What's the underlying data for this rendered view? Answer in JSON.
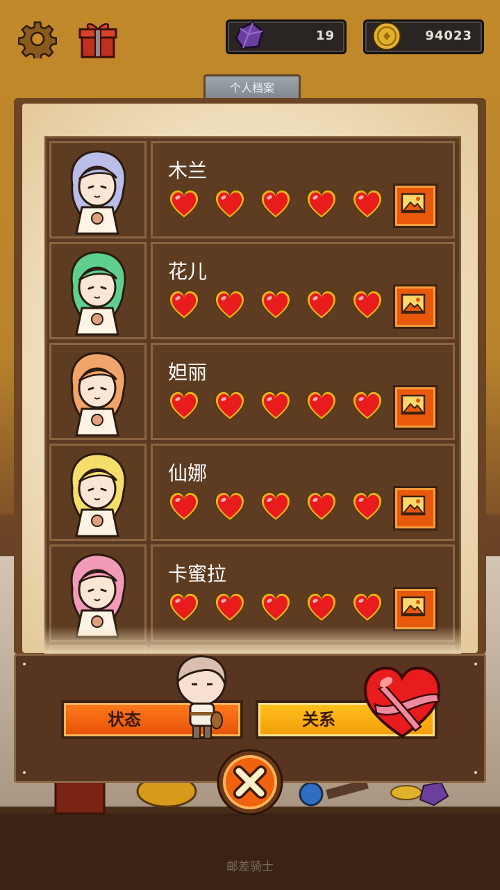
{
  "hud": {
    "gems": "19",
    "coins": "94023"
  },
  "panel": {
    "tab_title": "个人档案"
  },
  "characters": [
    {
      "name": "木兰",
      "hearts": 5,
      "max_hearts": 5,
      "hair_color": "#b9bde8"
    },
    {
      "name": "花儿",
      "hearts": 5,
      "max_hearts": 5,
      "hair_color": "#5fcf8e"
    },
    {
      "name": "妲丽",
      "hearts": 5,
      "max_hearts": 5,
      "hair_color": "#f2a56a"
    },
    {
      "name": "仙娜",
      "hearts": 5,
      "max_hearts": 5,
      "hair_color": "#f5df6a"
    },
    {
      "name": "卡蜜拉",
      "hearts": 5,
      "max_hearts": 5,
      "hair_color": "#f29bb8"
    }
  ],
  "tabs": {
    "status_label": "状态",
    "relation_label": "关系"
  },
  "footer": {
    "app_name": "邮差骑士"
  },
  "colors": {
    "heart": "#e81c1c",
    "album_button": "#e8590c",
    "status_tab": "#f0620e",
    "relation_tab": "#fbb215"
  }
}
